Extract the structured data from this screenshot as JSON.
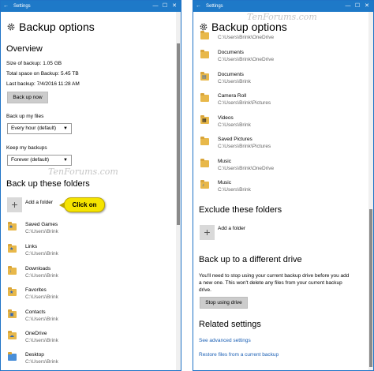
{
  "window": {
    "title": "Settings",
    "minimize": "—",
    "maximize": "☐",
    "close": "✕",
    "back": "←"
  },
  "watermark": "TenForums.com",
  "page_title": "Backup options",
  "overview": {
    "heading": "Overview",
    "size": "Size of backup: 1.05 GB",
    "total": "Total space on Backup: 5.45 TB",
    "last": "Last backup: 7/4/2016 11:28 AM",
    "backup_now": "Back up now"
  },
  "backup_my_files": {
    "label": "Back up my files",
    "value": "Every hour (default)"
  },
  "keep_backups": {
    "label": "Keep my backups",
    "value": "Forever (default)"
  },
  "backup_folders": {
    "heading": "Back up these folders",
    "add_folder": "Add a folder",
    "callout": "Click on"
  },
  "left_folders": [
    {
      "name": "Saved Games",
      "path": "C:\\Users\\Brink"
    },
    {
      "name": "Links",
      "path": "C:\\Users\\Brink"
    },
    {
      "name": "Downloads",
      "path": "C:\\Users\\Brink"
    },
    {
      "name": "Favorites",
      "path": "C:\\Users\\Brink"
    },
    {
      "name": "Contacts",
      "path": "C:\\Users\\Brink"
    },
    {
      "name": "OneDrive",
      "path": "C:\\Users\\Brink"
    },
    {
      "name": "Desktop",
      "path": "C:\\Users\\Brink"
    }
  ],
  "right_top_path": "C:\\Users\\Brink\\OneDrive",
  "right_folders": [
    {
      "name": "Documents",
      "path": "C:\\Users\\Brink\\OneDrive"
    },
    {
      "name": "Documents",
      "path": "C:\\Users\\Brink"
    },
    {
      "name": "Camera Roll",
      "path": "C:\\Users\\Brink\\Pictures"
    },
    {
      "name": "Videos",
      "path": "C:\\Users\\Brink"
    },
    {
      "name": "Saved Pictures",
      "path": "C:\\Users\\Brink\\Pictures"
    },
    {
      "name": "Music",
      "path": "C:\\Users\\Brink\\OneDrive"
    },
    {
      "name": "Music",
      "path": "C:\\Users\\Brink"
    }
  ],
  "exclude": {
    "heading": "Exclude these folders",
    "add_folder": "Add a folder"
  },
  "different_drive": {
    "heading": "Back up to a different drive",
    "line1": "You'll need to stop using your current backup drive before you add",
    "line2": "a new one. This won't delete any files from your current backup",
    "line3": "drive.",
    "button": "Stop using drive"
  },
  "related": {
    "heading": "Related settings",
    "advanced": "See advanced settings",
    "restore": "Restore files from a current backup"
  }
}
